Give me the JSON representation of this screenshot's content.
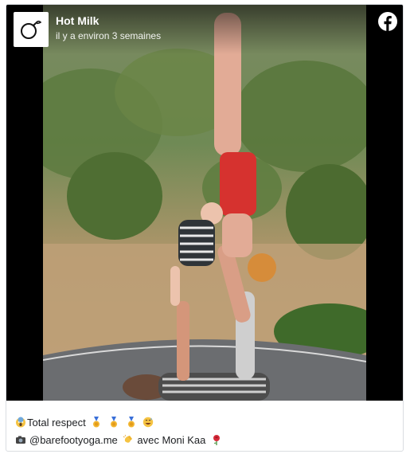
{
  "post": {
    "page_name": "Hot Milk",
    "timestamp": "il y a environ 3 semaines",
    "platform_icon": "facebook-icon",
    "avatar_icon": "bomb-logo-icon",
    "photo_description_icon": "acroyoga-photo",
    "caption": {
      "line1_text": "Total respect",
      "line1_icons": [
        "screaming-face-emoji",
        "medal-emoji",
        "medal-emoji",
        "medal-emoji",
        "grinning-sweat-emoji"
      ],
      "line2_handle": "@barefootyoga.me",
      "line2_suffix": "avec Moni Kaa",
      "line2_icons": [
        "camera-emoji",
        "clapping-hands-emoji",
        "rose-emoji"
      ]
    }
  },
  "colors": {
    "facebook_blue": "#ffffff",
    "border": "#dadde1",
    "text": "#1c1e21"
  }
}
